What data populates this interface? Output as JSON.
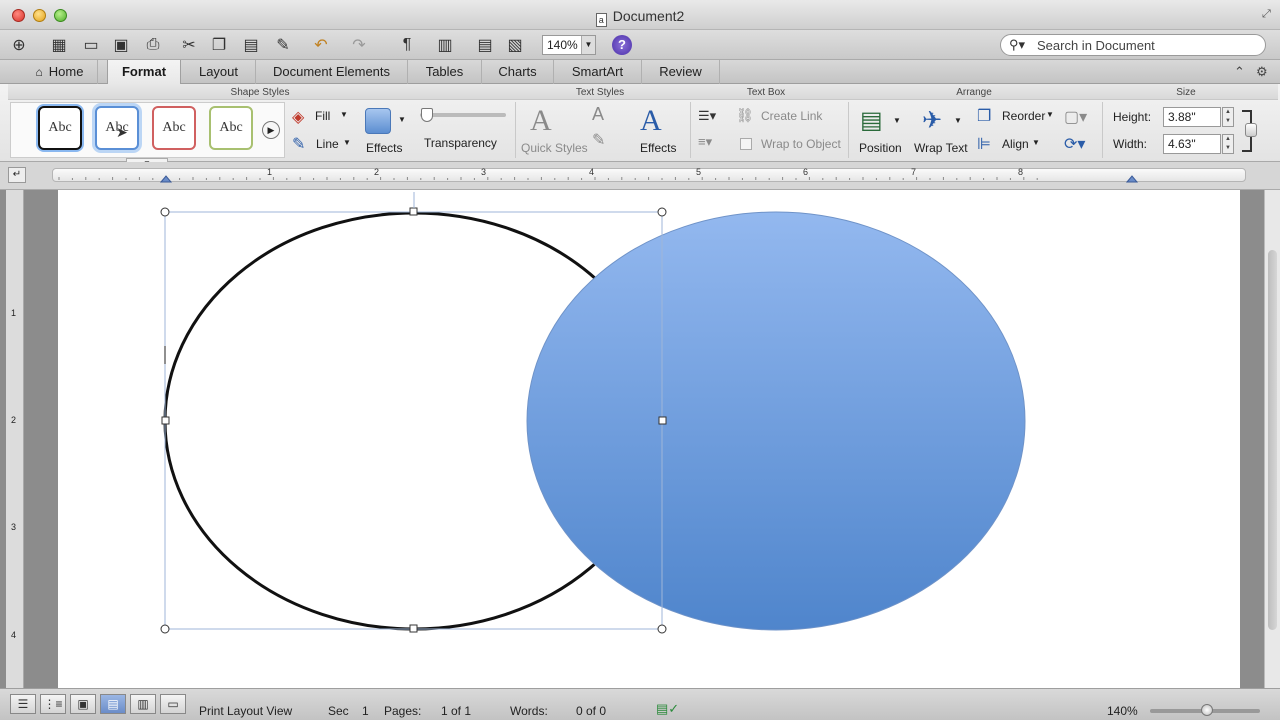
{
  "window": {
    "title": "Document2"
  },
  "toolbar": {
    "zoom": "140%",
    "search_placeholder": "Search in Document"
  },
  "tabs": [
    "Home",
    "Format",
    "Layout",
    "Document Elements",
    "Tables",
    "Charts",
    "SmartArt",
    "Review"
  ],
  "active_tab": "Format",
  "ribbon": {
    "groups": {
      "shape_styles": "Shape Styles",
      "text_styles": "Text Styles",
      "text_box": "Text Box",
      "arrange": "Arrange",
      "size": "Size"
    },
    "style_thumbs": [
      "Abc",
      "Abc",
      "Abc",
      "Abc"
    ],
    "fill": "Fill",
    "line": "Line",
    "effects": "Effects",
    "transparency": "Transparency",
    "quick_styles": "Quick Styles",
    "text_effects": "Effects",
    "create_link": "Create Link",
    "wrap_to_object": "Wrap to Object",
    "position": "Position",
    "wrap_text": "Wrap Text",
    "reorder": "Reorder",
    "align": "Align",
    "height_label": "Height:",
    "height_value": "3.88\"",
    "width_label": "Width:",
    "width_value": "4.63\""
  },
  "ruler": {
    "numbers": [
      "1",
      "2",
      "3",
      "4",
      "5",
      "6",
      "7",
      "8"
    ]
  },
  "vruler": {
    "numbers": [
      "1",
      "2",
      "3",
      "4"
    ]
  },
  "status": {
    "view": "Print Layout View",
    "sec_label": "Sec",
    "sec_value": "1",
    "pages_label": "Pages:",
    "pages_value": "1 of 1",
    "words_label": "Words:",
    "words_value": "0 of 0",
    "zoom": "140%"
  },
  "colors": {
    "blue_shape_top": "#93b8ef",
    "blue_shape_bottom": "#4f85cc",
    "accent": "#3b7fd6"
  }
}
